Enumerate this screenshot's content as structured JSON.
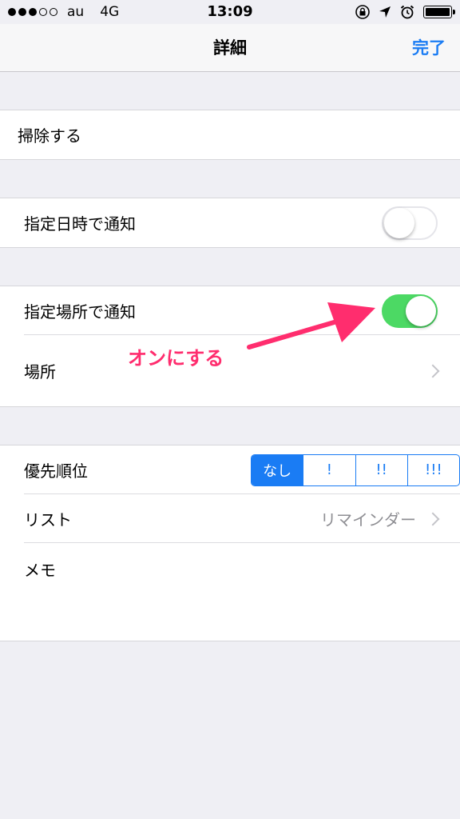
{
  "status_bar": {
    "carrier": "au",
    "network": "4G",
    "time": "13:09",
    "signal_filled": 3,
    "signal_total": 5
  },
  "nav": {
    "title": "詳細",
    "done_label": "完了"
  },
  "rows": {
    "clean": "掃除する",
    "notify_time": "指定日時で通知",
    "notify_location": "指定場所で通知",
    "location": "場所",
    "priority": "優先順位",
    "list": "リスト",
    "list_value": "リマインダー",
    "memo": "メモ"
  },
  "toggles": {
    "notify_time_on": false,
    "notify_location_on": true
  },
  "priority_options": [
    "なし",
    "!",
    "!!",
    "!!!"
  ],
  "annotation": {
    "text": "オンにする",
    "color": "#ff2d6e"
  },
  "colors": {
    "accent": "#1a7cf4",
    "toggle_on": "#4cd964"
  },
  "icons": {
    "lock_rotation": "lock-rotation-icon",
    "location_arrow": "location-arrow-icon",
    "alarm": "alarm-icon",
    "battery": "battery-icon"
  }
}
